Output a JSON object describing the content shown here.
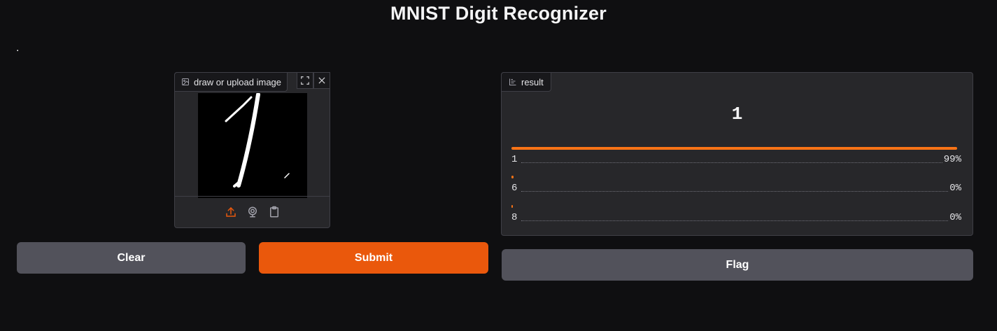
{
  "page": {
    "title": "MNIST Digit Recognizer",
    "description": "."
  },
  "image_input": {
    "label": "draw or upload image",
    "tools": [
      "fullscreen-icon",
      "close-icon"
    ],
    "sources": [
      "upload-icon",
      "webcam-icon",
      "clipboard-icon"
    ]
  },
  "buttons": {
    "clear": "Clear",
    "submit": "Submit",
    "flag": "Flag"
  },
  "result": {
    "label": "result",
    "top_prediction": "1",
    "confidences": [
      {
        "label": "1",
        "percent": "99%",
        "value": 0.99
      },
      {
        "label": "6",
        "percent": "0%",
        "value": 0.004
      },
      {
        "label": "8",
        "percent": "0%",
        "value": 0.002
      }
    ]
  },
  "colors": {
    "accent": "#ea580c",
    "bar": "#f97316",
    "background": "#0f0f11",
    "panel": "#27272a"
  }
}
